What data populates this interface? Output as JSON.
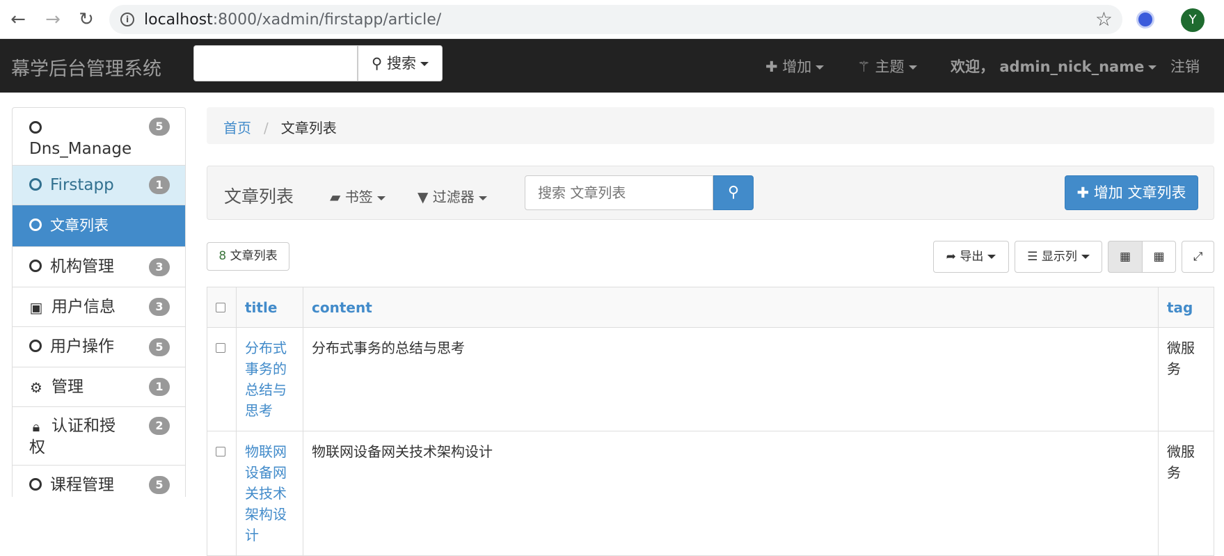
{
  "browser": {
    "url_host": "localhost",
    "url_rest": ":8000/xadmin/firstapp/article/",
    "profile_initial": "Y"
  },
  "topbar": {
    "brand": "幕学后台管理系统",
    "search_button": "搜索",
    "add": "增加",
    "theme": "主题",
    "welcome": "欢迎，",
    "username": "admin_nick_name",
    "logout": "注销"
  },
  "sidebar": {
    "items": [
      {
        "label": "Dns_Manage",
        "badge": "5"
      },
      {
        "label": "Firstapp",
        "badge": "1"
      },
      {
        "label": "文章列表"
      },
      {
        "label": "机构管理",
        "badge": "3"
      },
      {
        "label": "用户信息",
        "badge": "3"
      },
      {
        "label": "用户操作",
        "badge": "5"
      },
      {
        "label": "管理",
        "badge": "1"
      },
      {
        "label": "认证和授权",
        "badge": "2"
      },
      {
        "label": "课程管理",
        "badge": "5"
      }
    ]
  },
  "breadcrumb": {
    "home": "首页",
    "current": "文章列表"
  },
  "panel": {
    "title": "文章列表",
    "bookmarks": "书签",
    "filters": "过滤器",
    "search_placeholder": "搜索 文章列表",
    "add_button": "增加 文章列表"
  },
  "toolbar": {
    "count_num": "8",
    "count_label": "文章列表",
    "export": "导出",
    "columns": "显示列"
  },
  "table": {
    "headers": [
      "title",
      "content",
      "tag"
    ],
    "rows": [
      {
        "title": "分布式事务的总结与思考",
        "content": "分布式事务的总结与思考",
        "tag": "微服务"
      },
      {
        "title": "物联网设备网关技术架构设计",
        "content": "物联网设备网关技术架构设计",
        "tag": "微服务"
      }
    ]
  }
}
